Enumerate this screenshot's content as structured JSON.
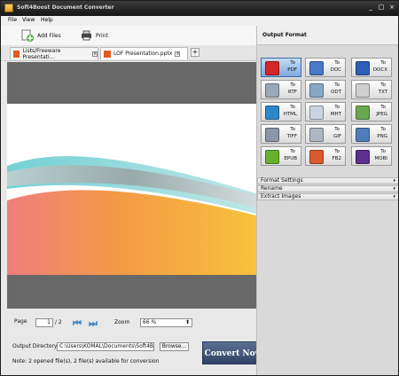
{
  "window": {
    "title": "Soft4Boost Document Converter",
    "minimize": "_",
    "maximize": "□",
    "close": "×"
  },
  "menu": [
    "File",
    "View",
    "Help"
  ],
  "toolbar": {
    "add_files": "Add Files",
    "print": "Print"
  },
  "tabs": [
    {
      "label": "Lists/Freeware Presentati...",
      "close": "×"
    },
    {
      "label": "LOF Presentation.pptx",
      "close": "×"
    }
  ],
  "add_tab": "+",
  "footer": {
    "page_label": "Page",
    "page_value": "1",
    "page_total": "/ 2",
    "zoom_label": "Zoom",
    "zoom_value": "66 %",
    "output_label": "Output Directory:",
    "output_path": "C:\\Users\\KOMAL\\Documents\\Soft4Boo",
    "browse": "Browse...",
    "note": "Note: 2 opened file(s), 2 file(s) available for conversion",
    "convert": "Convert Now"
  },
  "right_panel": {
    "title": "Output Format",
    "formats": [
      {
        "to": "To",
        "name": "PDF",
        "icon": "pdf-icon",
        "color": "#d52727"
      },
      {
        "to": "To",
        "name": "DOC",
        "icon": "doc-icon",
        "color": "#4a78c8"
      },
      {
        "to": "To",
        "name": "DOCX",
        "icon": "docx-icon",
        "color": "#2d5fb8"
      },
      {
        "to": "To",
        "name": "RTF",
        "icon": "rtf-icon",
        "color": "#9aa9b9"
      },
      {
        "to": "To",
        "name": "ODT",
        "icon": "odt-icon",
        "color": "#87a8c5"
      },
      {
        "to": "To",
        "name": "TXT",
        "icon": "txt-icon",
        "color": "#cfcfcf"
      },
      {
        "to": "To",
        "name": "HTML",
        "icon": "html-icon",
        "color": "#2b88c9"
      },
      {
        "to": "To",
        "name": "MHT",
        "icon": "mht-icon",
        "color": "#c9d4e0"
      },
      {
        "to": "To",
        "name": "JPEG",
        "icon": "jpeg-icon",
        "color": "#6aa84f"
      },
      {
        "to": "To",
        "name": "TIFF",
        "icon": "tiff-icon",
        "color": "#8c96a7"
      },
      {
        "to": "To",
        "name": "GIF",
        "icon": "gif-icon",
        "color": "#aeb6c2"
      },
      {
        "to": "To",
        "name": "PNG",
        "icon": "png-icon",
        "color": "#4f7db9"
      },
      {
        "to": "To",
        "name": "EPUB",
        "icon": "epub-icon",
        "color": "#67b12e"
      },
      {
        "to": "To",
        "name": "FB2",
        "icon": "fb2-icon",
        "color": "#d95b2c"
      },
      {
        "to": "To",
        "name": "MOBI",
        "icon": "mobi-icon",
        "color": "#5d2f91"
      }
    ],
    "accordion": [
      "Format Settings",
      "Rename",
      "Extract Images"
    ]
  }
}
